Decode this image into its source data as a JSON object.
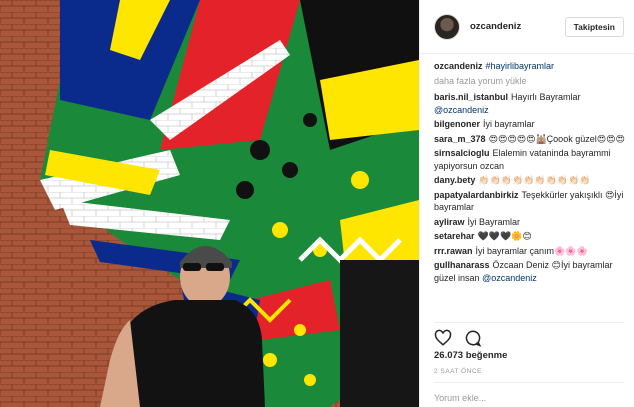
{
  "post": {
    "username": "ozcandeniz",
    "follow_label": "Takiptesin",
    "caption_user": "ozcandeniz",
    "caption_tag": "#hayirlibayramlar",
    "load_more": "daha fazla yorum yükle",
    "comments": [
      {
        "user": "baris.nil_istanbul",
        "text": "Hayırlı Bayramlar",
        "tag": "@ozcandeniz"
      },
      {
        "user": "bilgenoner",
        "text": "İyi bayramlar",
        "tag": ""
      },
      {
        "user": "sara_m_378",
        "text": "😍😍😍😍😍🕍Çoook güzel😍😍😍",
        "tag": ""
      },
      {
        "user": "sirnsalcioglu",
        "text": "Elalemin vataninda bayrammi yapiyorsun ozcan",
        "tag": ""
      },
      {
        "user": "dany.bety",
        "text": "👏🏻👏🏻👏🏻👏🏻👏🏻👏🏻👏🏻👏🏻👏🏻👏🏻",
        "tag": ""
      },
      {
        "user": "papatyalardanbirkiz",
        "text": "Teşekkürler yakışıklı 😍İyi bayramlar",
        "tag": ""
      },
      {
        "user": "ayliraw",
        "text": "İyi Bayramlar",
        "tag": ""
      },
      {
        "user": "setarehar",
        "text": "🖤🖤🖤🌼😊",
        "tag": ""
      },
      {
        "user": "rrr.rawan",
        "text": "İyi bayramlar çanım🌸🌸🌸",
        "tag": ""
      },
      {
        "user": "gullhanarass",
        "text": "Özcaan Deniz 😊İyi bayramlar güzel insan",
        "tag": "@ozcandeniz"
      }
    ],
    "likes": "26.073 beğenme",
    "time": "2 SAAT ÖNCE",
    "add_comment_placeholder": "Yorum ekle...",
    "icons": {
      "like": "heart-icon",
      "comment": "comment-icon"
    }
  }
}
